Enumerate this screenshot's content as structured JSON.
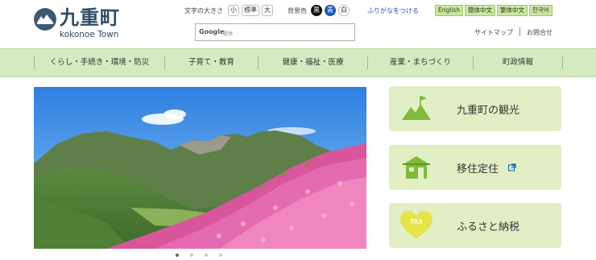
{
  "header": {
    "logo_title": "九重町",
    "logo_sub": "kokonoe Town",
    "font_size_label": "文字の大きさ",
    "font_size_options": [
      "小",
      "標準",
      "大"
    ],
    "bg_color_label": "背景色",
    "bg_color_options": [
      "黒",
      "青",
      "白"
    ],
    "furigana_label": "ふりがなをつける",
    "languages": [
      "English",
      "簡体中文",
      "繁体中文",
      "한국어"
    ],
    "search": {
      "brand": "Google",
      "placeholder": "提供"
    },
    "sitemap_label": "サイトマップ",
    "contact_label": "お問合せ"
  },
  "nav": {
    "items": [
      "くらし・手続き・環境・防災",
      "子育て・教育",
      "健康・福祉・医療",
      "産業・まちづくり",
      "町政情報"
    ]
  },
  "hero": {
    "slide_count": 4,
    "active_index": 0
  },
  "cards": [
    {
      "label": "九重町の観光",
      "icon": "mountain-flag-icon",
      "external": false
    },
    {
      "label": "移住定住",
      "icon": "house-icon",
      "external": true
    },
    {
      "label": "ふるさと納税",
      "icon": "tax-heart-icon",
      "icon_text": "TAX",
      "external": false
    }
  ],
  "colors": {
    "nav_bg": "#d6eac1",
    "card_bg": "#e2efc4",
    "icon_green": "#7fba3c",
    "lang_bg": "#c8e89c",
    "accent_blue": "#1d58b8",
    "logo_navy": "#2f4d66"
  }
}
